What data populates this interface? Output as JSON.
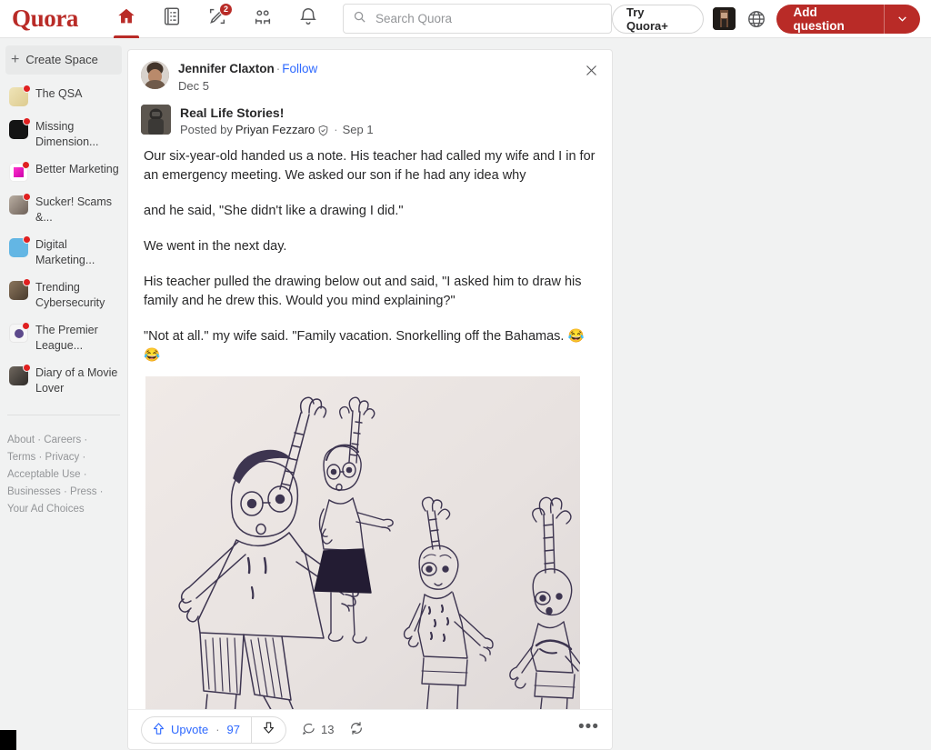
{
  "header": {
    "logo": "Quora",
    "nav": [
      {
        "name": "home-icon",
        "label": "Home",
        "badge": ""
      },
      {
        "name": "answer-icon",
        "label": "Answer",
        "badge": ""
      },
      {
        "name": "write-icon",
        "label": "Write",
        "badge": "2"
      },
      {
        "name": "spaces-icon",
        "label": "Spaces",
        "badge": ""
      },
      {
        "name": "notifications-icon",
        "label": "Notifications",
        "badge": ""
      }
    ],
    "search": {
      "placeholder": "Search Quora",
      "value": ""
    },
    "try_quora_plus": "Try Quora+",
    "language_icon": "globe-icon",
    "add_question": "Add question",
    "brand_color": "#b92b27",
    "link_color": "#2e69ff"
  },
  "sidebar": {
    "create_space": "Create Space",
    "spaces": [
      {
        "label": "The QSA",
        "color": "#e8dcb0",
        "has_dot": true
      },
      {
        "label": "Missing Dimension...",
        "color": "#1a1a1a",
        "has_dot": true
      },
      {
        "label": "Better Marketing",
        "color": "#ffffff",
        "has_dot": true
      },
      {
        "label": "Sucker! Scams &...",
        "color": "#8c7f74",
        "has_dot": true
      },
      {
        "label": "Digital Marketing...",
        "color": "#5fb3e0",
        "has_dot": true
      },
      {
        "label": "Trending Cybersecurity",
        "color": "#6b5a4a",
        "has_dot": true
      },
      {
        "label": "The Premier League...",
        "color": "#f4f4f4",
        "has_dot": true
      },
      {
        "label": "Diary of a Movie Lover",
        "color": "#3d3a36",
        "has_dot": true
      }
    ],
    "footer_links": [
      "About",
      "Careers",
      "Terms",
      "Privacy",
      "Acceptable Use",
      "Businesses",
      "Press",
      "Your Ad Choices"
    ]
  },
  "post": {
    "sharer": {
      "name": "Jennifer Claxton",
      "follow_label": "Follow",
      "date": "Dec 5"
    },
    "space": {
      "name": "Real Life Stories!",
      "posted_by_prefix": "Posted by",
      "poster": "Priyan Fezzaro",
      "verified_icon": "shield-check-icon",
      "date": "Sep 1"
    },
    "paragraphs": [
      "Our six-year-old handed us a note. His teacher had called my wife and I in for an emergency meeting. We asked our son if he had any idea why",
      "and he said, \"She didn't like a drawing I did.\"",
      "We went in the next day.",
      "His teacher pulled the drawing below out and said, \"I asked him to draw his family and he drew this. Would you mind explaining?\"",
      "\"Not at all.\" my wife said. \"Family vacation. Snorkelling off the Bahamas. 😂😂"
    ],
    "image": {
      "name": "child-family-drawing",
      "alt": "Pencil drawing by a child showing four family figures with raised arms on beige paper"
    },
    "actions": {
      "upvote_label": "Upvote",
      "upvote_count": "97",
      "downvote_icon": "downvote-arrow-icon",
      "comment_count": "13",
      "share_icon": "repost-icon",
      "more_icon": "ellipsis-icon"
    }
  }
}
